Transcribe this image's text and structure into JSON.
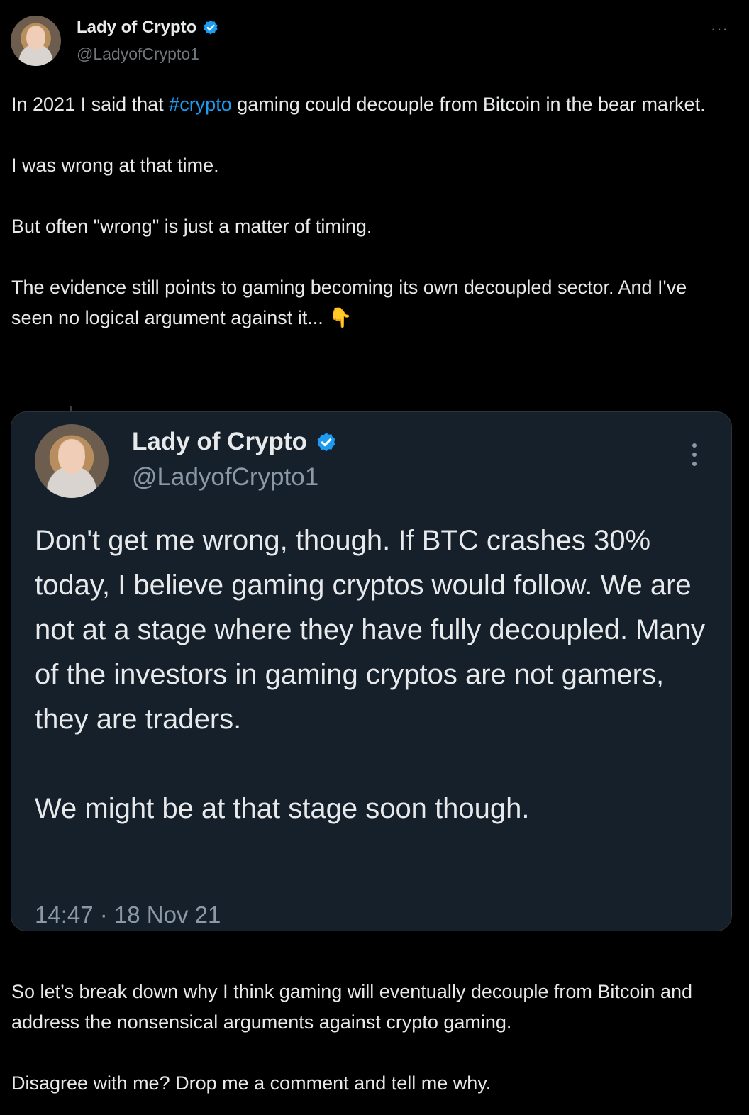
{
  "author": {
    "name": "Lady of Crypto",
    "handle": "@LadyofCrypto1",
    "verified": true,
    "more_icon": "more-horizontal-icon"
  },
  "tweet": {
    "paragraphs": [
      {
        "before": "In 2021 I said that ",
        "hashtag": "#crypto",
        "after": " gaming could decouple from Bitcoin in the bear market."
      },
      {
        "text": "I was wrong at that time."
      },
      {
        "text": "But often \"wrong\" is just a matter of timing."
      },
      {
        "text": "The evidence still points to gaming becoming its own decoupled sector. And I've seen no logical argument against it... 👇"
      }
    ],
    "closing": [
      "So let’s break down why I think gaming will eventually decouple from Bitcoin and address the nonsensical arguments against crypto gaming.",
      "Disagree with me? Drop me a comment and tell me why."
    ]
  },
  "quoted": {
    "name": "Lady of Crypto",
    "handle": "@LadyofCrypto1",
    "verified": true,
    "more_icon": "more-vertical-icon",
    "paragraphs": [
      "Don't get me wrong, though. If BTC crashes 30% today, I believe gaming cryptos would follow. We are not at a stage where they have fully decoupled. Many of the investors in gaming cryptos are not gamers, they are traders.",
      "We might be at that stage soon though."
    ],
    "timestamp": "14:47 · 18 Nov 21"
  },
  "colors": {
    "background": "#000000",
    "text": "#e7e9ea",
    "secondary": "#71767b",
    "accent": "#1d9bf0",
    "card": "#15202b"
  }
}
